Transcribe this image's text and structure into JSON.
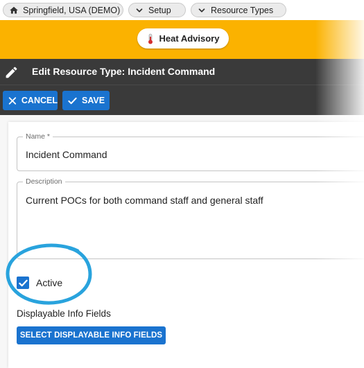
{
  "breadcrumbs": [
    {
      "label": "Springfield, USA (DEMO)",
      "icon": "home-icon"
    },
    {
      "label": "Setup",
      "icon": "chevron-down-icon"
    },
    {
      "label": "Resource Types",
      "icon": "chevron-down-icon"
    }
  ],
  "alert": {
    "label": "Heat Advisory",
    "icon": "thermometer-icon",
    "band_color": "#fbb200"
  },
  "header": {
    "title": "Edit Resource Type: Incident Command",
    "icon": "pencil-icon"
  },
  "toolbar": {
    "cancel_label": "CANCEL",
    "save_label": "SAVE",
    "button_color": "#1a73cf"
  },
  "form": {
    "name": {
      "label": "Name *",
      "value": "Incident Command"
    },
    "description": {
      "label": "Description",
      "value": "Current POCs for both command staff and general staff"
    },
    "active": {
      "label": "Active",
      "checked": true
    },
    "displayable_info": {
      "label": "Displayable Info Fields",
      "button_label": "SELECT DISPLAYABLE INFO FIELDS"
    }
  },
  "highlight": {
    "color": "#29a3dd",
    "target": "active-checkbox"
  }
}
